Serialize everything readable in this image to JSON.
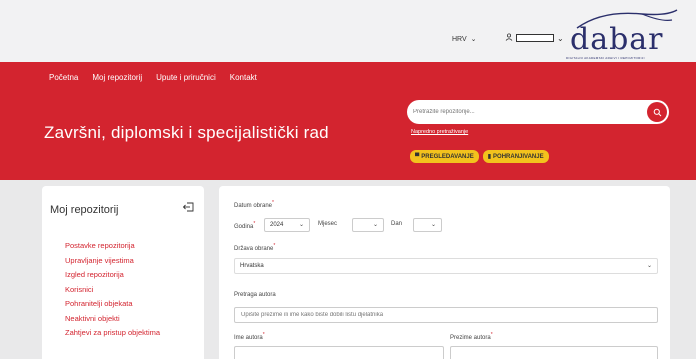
{
  "header": {
    "language": "HRV",
    "logo_word": "dabar",
    "logo_subtitle": "DIGITALNI AKADEMSKI ARHIVI I REPOZITORIJI"
  },
  "nav": {
    "items": [
      "Početna",
      "Moj repozitorij",
      "Upute i priručnici",
      "Kontakt"
    ]
  },
  "hero": {
    "title": "Završni, diplomski i specijalistički rad"
  },
  "search": {
    "placeholder": "Pretražite repozitorije...",
    "advanced_link": "Napredno pretraživanje",
    "browse_button": "PREGLEDAVANJE",
    "deposit_button": "POHRANJIVANJE"
  },
  "sidebar": {
    "title": "Moj repozitorij",
    "items": [
      "Postavke repozitorija",
      "Upravljanje vijestima",
      "Izgled repozitorija",
      "Korisnici",
      "Pohranitelji objekata",
      "Neaktivni objekti",
      "Zahtjevi za pristup objektima"
    ]
  },
  "form": {
    "date_label": "Datum obrane",
    "year_label": "Godina",
    "year_value": "2024",
    "month_label": "Mjesec",
    "month_value": "",
    "day_label": "Dan",
    "day_value": "",
    "country_label": "Država obrane",
    "country_value": "Hrvatska",
    "author_search_label": "Pretraga autora",
    "author_search_placeholder": "Upišite prezime ili ime kako biste dobili listu djelatnika",
    "author_first_label": "Ime autora",
    "author_last_label": "Prezime autora",
    "required_mark": "*"
  },
  "colors": {
    "brand_red": "#d3242f",
    "accent_yellow": "#f3c21d",
    "logo_navy": "#2b2f6b"
  }
}
